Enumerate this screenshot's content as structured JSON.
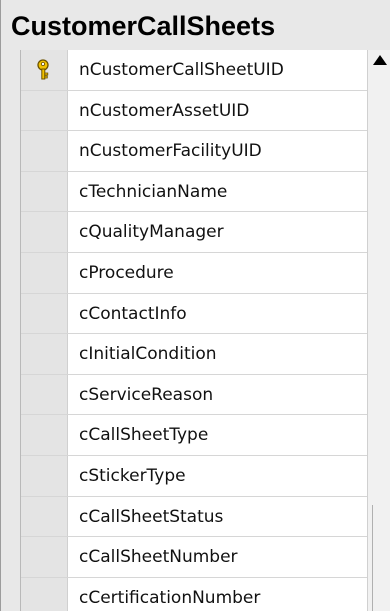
{
  "table": {
    "title": "CustomerCallSheets",
    "columns": [
      {
        "name": "nCustomerCallSheetUID",
        "primary_key": true
      },
      {
        "name": "nCustomerAssetUID",
        "primary_key": false
      },
      {
        "name": "nCustomerFacilityUID",
        "primary_key": false
      },
      {
        "name": "cTechnicianName",
        "primary_key": false
      },
      {
        "name": "cQualityManager",
        "primary_key": false
      },
      {
        "name": "cProcedure",
        "primary_key": false
      },
      {
        "name": "cContactInfo",
        "primary_key": false
      },
      {
        "name": "cInitialCondition",
        "primary_key": false
      },
      {
        "name": "cServiceReason",
        "primary_key": false
      },
      {
        "name": "cCallSheetType",
        "primary_key": false
      },
      {
        "name": "cStickerType",
        "primary_key": false
      },
      {
        "name": "cCallSheetStatus",
        "primary_key": false
      },
      {
        "name": "cCallSheetNumber",
        "primary_key": false
      },
      {
        "name": "cCertificationNumber",
        "primary_key": false
      }
    ]
  },
  "icons": {
    "primary_key": "key-icon",
    "scroll_up": "triangle-up-icon"
  },
  "colors": {
    "key_gold": "#e6b800",
    "panel_bg": "#e8e8e8"
  }
}
